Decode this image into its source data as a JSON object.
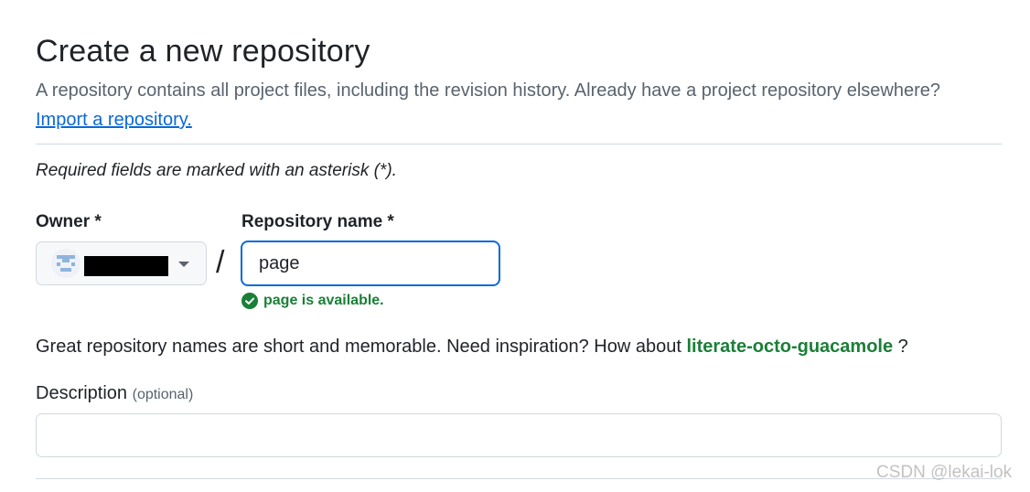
{
  "header": {
    "title": "Create a new repository",
    "subtitle": "A repository contains all project files, including the revision history. Already have a project repository elsewhere?",
    "import_link": "Import a repository."
  },
  "form": {
    "required_note": "Required fields are marked with an asterisk (*).",
    "owner": {
      "label": "Owner *",
      "selected_value": ""
    },
    "separator": "/",
    "repo_name": {
      "label": "Repository name *",
      "value": "page",
      "availability": "page is available."
    },
    "suggestion": {
      "prefix": "Great repository names are short and memorable. Need inspiration? How about",
      "name": "literate-octo-guacamole",
      "suffix": "?"
    },
    "description": {
      "label": "Description",
      "optional": "(optional)",
      "value": ""
    }
  },
  "watermark": "CSDN @lekai-lok",
  "colors": {
    "accent": "#0969da",
    "success": "#1a7f37",
    "muted": "#59636e",
    "border": "#d1d9e0"
  },
  "icons": {
    "owner_avatar": "identicon-avatar",
    "dropdown": "caret-down-icon",
    "availability": "check-circle-icon"
  }
}
